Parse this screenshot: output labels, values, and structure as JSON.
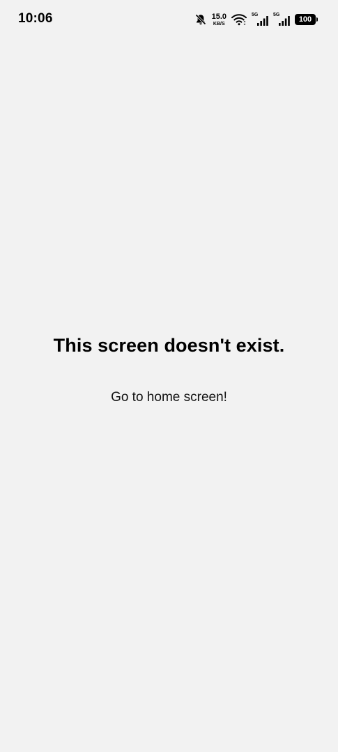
{
  "status_bar": {
    "time": "10:06",
    "net_speed_value": "15.0",
    "net_speed_unit": "KB/S",
    "signal_1_label": "5G",
    "signal_2_label": "5G",
    "battery": "100",
    "icons": [
      "bell-muted-icon",
      "wifi-icon",
      "signal-icon",
      "signal-icon",
      "battery-icon"
    ]
  },
  "main": {
    "title": "This screen doesn't exist.",
    "link_label": "Go to home screen!"
  }
}
